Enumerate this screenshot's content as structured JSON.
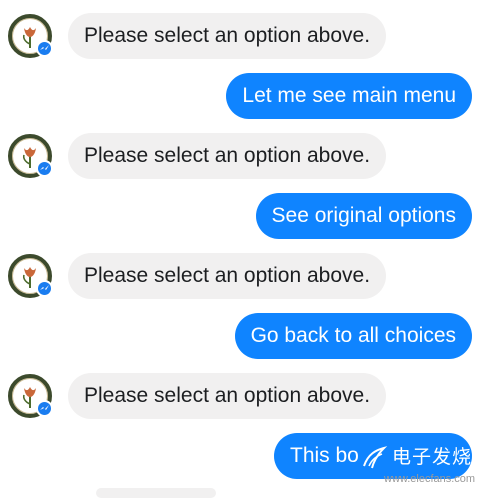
{
  "messages": [
    {
      "side": "bot",
      "text": "Please select an option above."
    },
    {
      "side": "user",
      "text": "Let me see main menu"
    },
    {
      "side": "bot",
      "text": "Please select an option above."
    },
    {
      "side": "user",
      "text": "See original options"
    },
    {
      "side": "bot",
      "text": "Please select an option above."
    },
    {
      "side": "user",
      "text": "Go back to all choices"
    },
    {
      "side": "bot",
      "text": "Please select an option above."
    },
    {
      "side": "user",
      "text": "This bo"
    }
  ],
  "watermark": {
    "text": "电子发烧友",
    "url": "www.elecfans.com"
  },
  "icons": {
    "avatar": "tulip-logo-avatar",
    "badge": "messenger-icon"
  },
  "colors": {
    "user_bubble": "#0f84ff",
    "bot_bubble": "#f1f0f0",
    "messenger_badge": "#1a7df0"
  }
}
